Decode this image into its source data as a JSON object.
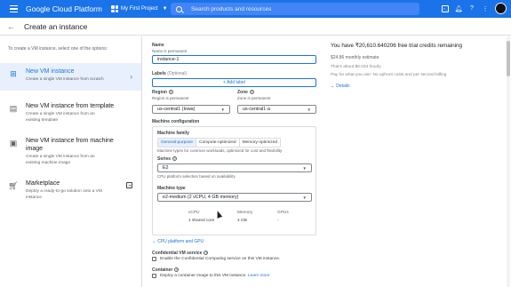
{
  "topbar": {
    "brand": "Google Cloud Platform",
    "project": "My First Project",
    "search_placeholder": "Search products and resources"
  },
  "header": {
    "title": "Create an instance"
  },
  "left_panel": {
    "intro": "To create a VM instance, select one of the options:",
    "options": [
      {
        "title": "New VM instance",
        "desc": "Create a single VM instance from scratch",
        "icon": "add-box-icon"
      },
      {
        "title": "New VM instance from template",
        "desc": "Create a single VM instance from an existing template",
        "icon": "template-icon"
      },
      {
        "title": "New VM instance from machine image",
        "desc": "Create a single VM instance from an existing machine image",
        "icon": "machine-image-icon"
      },
      {
        "title": "Marketplace",
        "desc": "Deploy a ready-to-go solution onto a VM instance",
        "icon": "cart-icon"
      }
    ]
  },
  "form": {
    "name_label": "Name",
    "name_sub": "Name is permanent",
    "name_value": "instance-1",
    "labels_label": "Labels",
    "labels_optional": "(Optional)",
    "add_label": "+ Add label",
    "region_label": "Region",
    "region_sub": "Region is permanent",
    "region_value": "us-central1 (Iowa)",
    "zone_label": "Zone",
    "zone_sub": "Zone is permanent",
    "zone_value": "us-central1-a",
    "machine_config": "Machine configuration",
    "machine_family": "Machine family",
    "tabs": [
      "General-purpose",
      "Compute-optimized",
      "Memory-optimized"
    ],
    "family_desc": "Machine types for common workloads, optimized for cost and flexibility",
    "series_label": "Series",
    "series_value": "E2",
    "series_desc": "CPU platform selection based on availability",
    "type_label": "Machine type",
    "type_value": "e2-medium (2 vCPU, 4 GB memory)",
    "spec_headers": [
      "vCPU",
      "Memory",
      "GPUs"
    ],
    "spec_values": [
      "1 shared core",
      "4 GB",
      "-"
    ],
    "cpu_link": "CPU platform and GPU",
    "confidential_label": "Confidential VM service",
    "confidential_text": "Enable the Confidential Computing service on this VM instance.",
    "container_label": "Container",
    "container_text": "Deploy a container image to this VM instance.",
    "learn_more": "Learn more"
  },
  "summary": {
    "credit": "You have ₹20,610.640206 free trial credits remaining",
    "estimate": "$24.86 monthly estimate",
    "hourly": "That's about $0.034 hourly",
    "pay": "Pay for what you use: No upfront costs and per second billing",
    "details": "Details"
  }
}
